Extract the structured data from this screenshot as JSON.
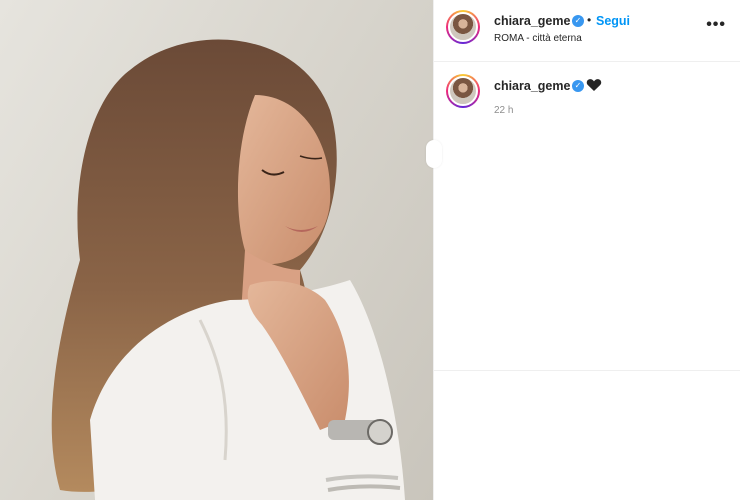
{
  "post": {
    "username": "chiara_geme",
    "verified": true,
    "separator": "•",
    "follow_label": "Segui",
    "location": "ROMA - città eterna",
    "more_icon": "more-options-icon",
    "more_glyph": "•••"
  },
  "caption": {
    "username": "chiara_geme",
    "emoji": "black-heart",
    "time_ago": "22 h"
  },
  "colors": {
    "link_blue": "#0095f6",
    "verified_blue": "#3897f0",
    "muted": "#8e8e8e",
    "text": "#262626"
  }
}
